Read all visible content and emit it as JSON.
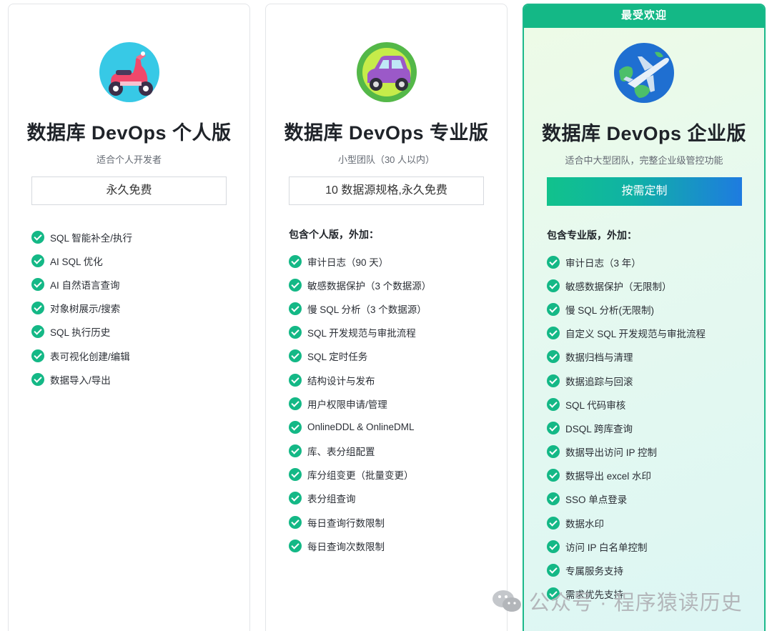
{
  "cards": [
    {
      "id": "personal",
      "title": "数据库 DevOps 个人版",
      "subtitle": "适合个人开发者",
      "price_label": "永久免费",
      "illustration": "scooter-icon",
      "include_heading": "",
      "features": [
        "SQL 智能补全/执行",
        "AI SQL 优化",
        "AI 自然语言查询",
        "对象树展示/搜索",
        "SQL 执行历史",
        "表可视化创建/编辑",
        "数据导入/导出"
      ]
    },
    {
      "id": "pro",
      "title": "数据库 DevOps 专业版",
      "subtitle": "小型团队（30 人以内）",
      "price_label": "10 数据源规格,永久免费",
      "illustration": "car-icon",
      "include_heading": "包含个人版，外加：",
      "features": [
        "审计日志（90 天）",
        "敏感数据保护（3 个数据源）",
        "慢 SQL 分析（3 个数据源）",
        "SQL 开发规范与审批流程",
        "SQL 定时任务",
        "结构设计与发布",
        "用户权限申请/管理",
        "OnlineDDL & OnlineDML",
        "库、表分组配置",
        "库分组变更（批量变更）",
        "表分组查询",
        "每日查询行数限制",
        "每日查询次数限制"
      ]
    },
    {
      "id": "enterprise",
      "ribbon": "最受欢迎",
      "title": "数据库 DevOps 企业版",
      "subtitle": "适合中大型团队，完整企业级管控功能",
      "price_label": "按需定制",
      "illustration": "airplane-globe-icon",
      "include_heading": "包含专业版，外加：",
      "features": [
        "审计日志（3 年）",
        "敏感数据保护（无限制）",
        "慢 SQL 分析(无限制)",
        "自定义 SQL 开发规范与审批流程",
        "数据归档与清理",
        "数据追踪与回滚",
        "SQL 代码审核",
        "DSQL 跨库查询",
        "数据导出访问 IP 控制",
        "数据导出 excel 水印",
        "SSO 单点登录",
        "数据水印",
        "访问 IP 白名单控制",
        "专属服务支持",
        "需求优先支持"
      ]
    }
  ],
  "watermark": {
    "text": "公众号 · 程序猿读历史",
    "icon": "wechat-icon"
  },
  "colors": {
    "accent": "#14b886",
    "button_gradient_start": "#11c28c",
    "button_gradient_end": "#1e7be0",
    "ribbon": "#14b886"
  }
}
